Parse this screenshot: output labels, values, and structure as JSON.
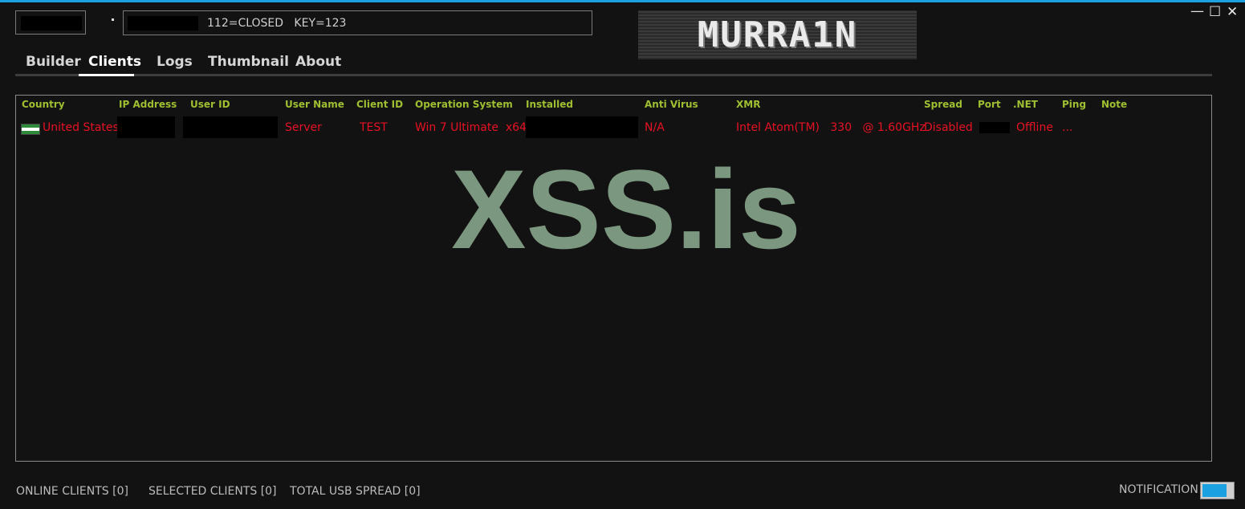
{
  "window": {
    "status_text": "112=CLOSED   KEY=123",
    "logo_text": "MURRA1N",
    "minimize_glyph": "—",
    "maximize_glyph": "☐",
    "close_glyph": "✕"
  },
  "tabs": [
    {
      "label": "Builder",
      "selected": false
    },
    {
      "label": "Clients",
      "selected": true
    },
    {
      "label": "Logs",
      "selected": false
    },
    {
      "label": "Thumbnail",
      "selected": false
    },
    {
      "label": "About",
      "selected": false
    }
  ],
  "table": {
    "headers": [
      "Country",
      "IP Address",
      "User ID",
      "User Name",
      "Client ID",
      "Operation System",
      "Installed",
      "Anti Virus",
      "XMR",
      "Spread",
      "Port",
      ".NET",
      "Ping",
      "Note"
    ],
    "rows": [
      {
        "country": "United States",
        "ip_address": "",
        "user_id": "",
        "user_name": "Server",
        "client_id": "TEST",
        "os": "Win 7 Ultimate  x64",
        "installed": "",
        "anti_virus": "N/A",
        "xmr": "Intel Atom(TM)   330   @ 1.60GHz",
        "spread": "Disabled",
        "port": "",
        "dotnet": "Offline",
        "ping": "...",
        "note": ""
      }
    ]
  },
  "watermark": "XSS.is",
  "footer": {
    "online_clients": "ONLINE CLIENTS [0]",
    "selected_clients": "SELECTED CLIENTS [0]",
    "total_usb_spread": "TOTAL USB SPREAD [0]",
    "notification_label": "NOTIFICATION",
    "notification_on": true
  },
  "colors": {
    "accent": "#1ba1e2",
    "header_text": "#9fbf32",
    "row_text": "#e81123",
    "watermark": "#7c977f",
    "background": "#121212"
  },
  "icons": {
    "flag": "flag-icon"
  }
}
